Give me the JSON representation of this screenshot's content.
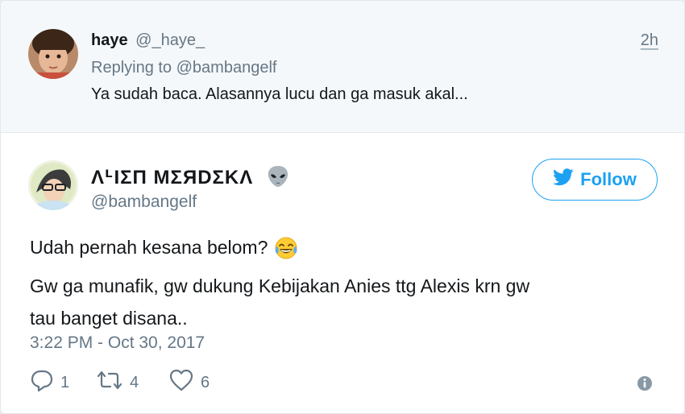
{
  "reply_tweet": {
    "author_name": "haye",
    "author_handle": "@_haye_",
    "time": "2h",
    "replying_prefix": "Replying to",
    "replying_handle": "@bambangelf",
    "text": "Ya sudah baca. Alasannya lucu dan ga masuk akal..."
  },
  "main_tweet": {
    "display_name": "ΛᒻΙΣΠ ΜΣЯDΣΚΛ",
    "name_emoji_icon": "alien-icon",
    "handle": "@bambangelf",
    "follow_label": "Follow",
    "text_line1": "Udah pernah kesana belom?",
    "text_line1_emoji": "face-with-tears-of-joy",
    "text_line2": "Gw ga munafik, gw dukung Kebijakan Anies ttg Alexis krn gw",
    "text_line3": "tau banget disana..",
    "timestamp": "3:22 PM - Oct 30, 2017",
    "actions": {
      "replies": "1",
      "retweets": "4",
      "likes": "6"
    }
  },
  "colors": {
    "twitter_blue": "#1da1f2",
    "muted_text": "#657786",
    "reply_background": "#f5f8fa"
  }
}
